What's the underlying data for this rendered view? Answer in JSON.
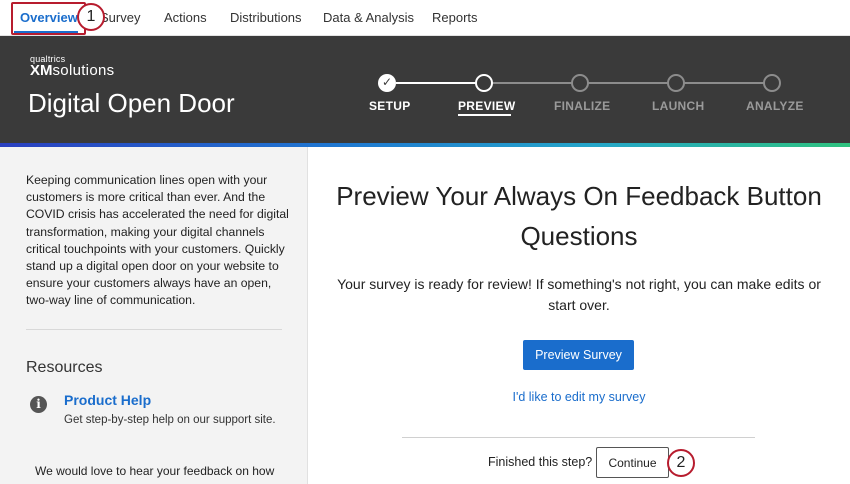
{
  "nav": {
    "tabs": [
      {
        "label": "Overview"
      },
      {
        "label": "Survey"
      },
      {
        "label": "Actions"
      },
      {
        "label": "Distributions"
      },
      {
        "label": "Data & Analysis"
      },
      {
        "label": "Reports"
      }
    ],
    "active_tab": "Overview"
  },
  "callouts": {
    "one": "1",
    "two": "2"
  },
  "banner": {
    "logo_small": "qualtrics",
    "logo_xm": "XM",
    "logo_solutions": "solutions",
    "title": "Digital Open Door"
  },
  "stepper": {
    "steps": [
      {
        "label": "SETUP",
        "state": "done"
      },
      {
        "label": "PREVIEW",
        "state": "current"
      },
      {
        "label": "FINALIZE",
        "state": "future"
      },
      {
        "label": "LAUNCH",
        "state": "future"
      },
      {
        "label": "ANALYZE",
        "state": "future"
      }
    ],
    "check_glyph": "✓"
  },
  "left": {
    "intro": "Keeping communication lines open with your customers is more critical than ever. And the COVID crisis has accelerated the need for digital transformation, making your digital channels critical touchpoints with your customers. Quickly stand up a digital open door on your website to ensure your customers always have an open, two-way line of communication.",
    "resources_title": "Resources",
    "info_glyph": "i",
    "help_link": "Product Help",
    "help_desc": "Get step-by-step help on our support site.",
    "feedback": "We would love to hear your feedback on how"
  },
  "main": {
    "title": "Preview Your Always On Feedback Button Questions",
    "description": "Your survey is ready for review! If something's not right, you can make edits or start over.",
    "preview_button": "Preview Survey",
    "edit_link": "I'd like to edit my survey",
    "finished_label": "Finished this step?",
    "continue_button": "Continue"
  },
  "colors": {
    "accent": "#1a6dcc",
    "banner": "#3a3a3a",
    "callout": "#b71c2e"
  }
}
